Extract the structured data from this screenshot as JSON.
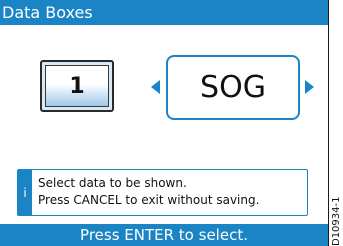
{
  "title": "Data Boxes",
  "data_box_number": "1",
  "selected_data": "SOG",
  "info": {
    "icon_glyph": "i",
    "line1": "Select data to be shown.",
    "line2": "Press CANCEL to exit without saving."
  },
  "footer": "Press ENTER to select.",
  "figure_id": "D10934-1",
  "colors": {
    "accent": "#1a84c5",
    "box_fill": "#d7e9f7"
  }
}
